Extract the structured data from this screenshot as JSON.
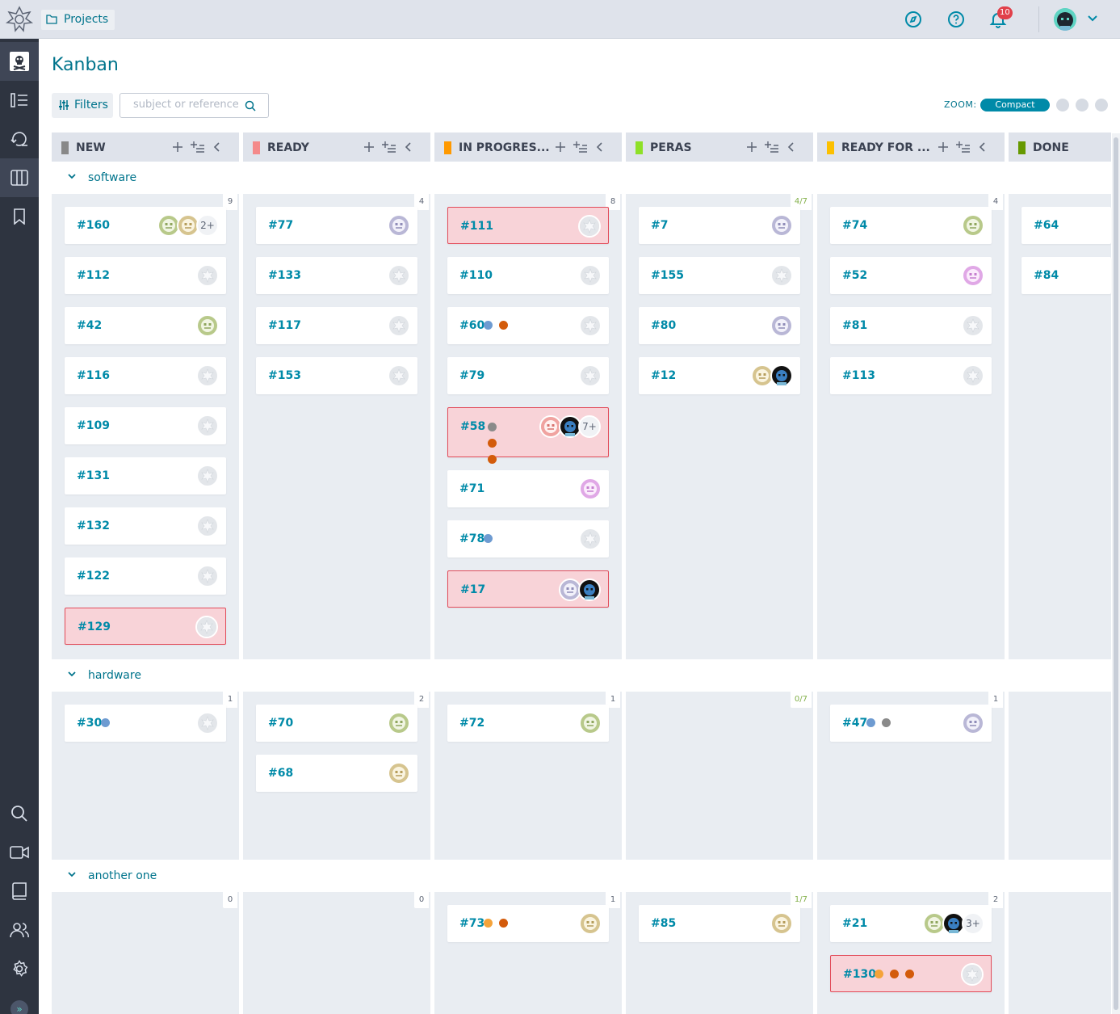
{
  "topbar": {
    "projects_label": "Projects",
    "notifications_count": "10",
    "icons": [
      "logo-icon",
      "folder-icon",
      "compass-icon",
      "help-icon",
      "bell-icon",
      "user-avatar",
      "chevron-down-icon"
    ]
  },
  "sidebar": {
    "items": [
      "project-logo-icon",
      "backlog-icon",
      "epics-icon",
      "kanban-icon",
      "bookmark-icon",
      "search-icon",
      "video-icon",
      "wiki-icon",
      "team-icon",
      "settings-icon"
    ],
    "expand_label": "»"
  },
  "page": {
    "title": "Kanban",
    "filters_label": "Filters",
    "search_placeholder": "subject or reference",
    "zoom_label": "ZOOM:",
    "zoom_active": "Compact"
  },
  "colors": {
    "accent": "#008aa8",
    "blocked_bg": "#f8d3d8",
    "blocked_border": "#e24c5a",
    "tag_blue": "#6e9bd1",
    "tag_orange": "#d35b0b",
    "tag_grey": "#8a8a8a",
    "tag_yellow": "#f5a33a",
    "tag_light": "#c7d3d8"
  },
  "columns": [
    {
      "name": "NEW",
      "color": "#888888"
    },
    {
      "name": "READY",
      "color": "#f48a8a"
    },
    {
      "name": "IN PROGRES...",
      "color": "#ff9900"
    },
    {
      "name": "PERAS",
      "color": "#8ee027"
    },
    {
      "name": "READY FOR ...",
      "color": "#fcc000"
    },
    {
      "name": "DONE",
      "color": "#669900"
    }
  ],
  "swimlanes": [
    {
      "name": "software",
      "counts": [
        "9",
        "4",
        "8",
        "4/7",
        "4",
        ""
      ],
      "cards": [
        [
          {
            "ref": "#160",
            "avatars": [
              "green",
              "tan"
            ],
            "more": "2+"
          },
          {
            "ref": "#112",
            "avatars": [
              "empty"
            ]
          },
          {
            "ref": "#42",
            "avatars": [
              "green"
            ]
          },
          {
            "ref": "#116",
            "avatars": [
              "empty"
            ]
          },
          {
            "ref": "#109",
            "avatars": [
              "empty"
            ]
          },
          {
            "ref": "#131",
            "avatars": [
              "empty"
            ]
          },
          {
            "ref": "#132",
            "avatars": [
              "empty"
            ]
          },
          {
            "ref": "#122",
            "avatars": [
              "empty"
            ]
          },
          {
            "ref": "#129",
            "avatars": [
              "empty"
            ],
            "blocked": true
          }
        ],
        [
          {
            "ref": "#77",
            "avatars": [
              "lavender"
            ]
          },
          {
            "ref": "#133",
            "avatars": [
              "empty"
            ]
          },
          {
            "ref": "#117",
            "avatars": [
              "empty"
            ]
          },
          {
            "ref": "#153",
            "avatars": [
              "empty"
            ]
          }
        ],
        [
          {
            "ref": "#111",
            "avatars": [
              "empty"
            ],
            "blocked": true
          },
          {
            "ref": "#110",
            "avatars": [
              "empty"
            ]
          },
          {
            "ref": "#60",
            "tags": [
              "blue",
              "orange"
            ],
            "avatars": [
              "empty"
            ]
          },
          {
            "ref": "#79",
            "avatars": [
              "empty"
            ]
          },
          {
            "ref": "#58",
            "tags": [
              "grey",
              "orange",
              "orange",
              "light"
            ],
            "avatars": [
              "pink",
              "dark"
            ],
            "more": "7+",
            "blocked": true
          },
          {
            "ref": "#71",
            "avatars": [
              "purple"
            ]
          },
          {
            "ref": "#78",
            "tags": [
              "blue"
            ],
            "avatars": [
              "empty"
            ]
          },
          {
            "ref": "#17",
            "avatars": [
              "lavender",
              "dark"
            ],
            "blocked": true
          }
        ],
        [
          {
            "ref": "#7",
            "avatars": [
              "lavender"
            ]
          },
          {
            "ref": "#155",
            "avatars": [
              "empty"
            ]
          },
          {
            "ref": "#80",
            "avatars": [
              "lavender"
            ]
          },
          {
            "ref": "#12",
            "avatars": [
              "tan",
              "dark"
            ]
          }
        ],
        [
          {
            "ref": "#74",
            "avatars": [
              "green"
            ]
          },
          {
            "ref": "#52",
            "avatars": [
              "purple"
            ]
          },
          {
            "ref": "#81",
            "avatars": [
              "empty"
            ]
          },
          {
            "ref": "#113",
            "avatars": [
              "empty"
            ]
          }
        ],
        [
          {
            "ref": "#64",
            "avatars": []
          },
          {
            "ref": "#84",
            "avatars": []
          }
        ]
      ]
    },
    {
      "name": "hardware",
      "counts": [
        "1",
        "2",
        "1",
        "0/7",
        "1",
        ""
      ],
      "cards": [
        [
          {
            "ref": "#30",
            "tags": [
              "blue"
            ],
            "avatars": [
              "empty"
            ]
          }
        ],
        [
          {
            "ref": "#70",
            "avatars": [
              "green"
            ]
          },
          {
            "ref": "#68",
            "avatars": [
              "tan"
            ]
          }
        ],
        [
          {
            "ref": "#72",
            "avatars": [
              "green"
            ]
          }
        ],
        [],
        [
          {
            "ref": "#47",
            "tags": [
              "blue",
              "grey"
            ],
            "avatars": [
              "lavender"
            ]
          }
        ],
        []
      ]
    },
    {
      "name": "another one",
      "counts": [
        "0",
        "0",
        "1",
        "1/7",
        "2",
        ""
      ],
      "cards": [
        [],
        [],
        [
          {
            "ref": "#73",
            "tags": [
              "yellow",
              "orange"
            ],
            "avatars": [
              "tan"
            ]
          }
        ],
        [
          {
            "ref": "#85",
            "avatars": [
              "tan"
            ]
          }
        ],
        [
          {
            "ref": "#21",
            "avatars": [
              "green",
              "dark"
            ],
            "more": "3+"
          },
          {
            "ref": "#130",
            "tags": [
              "yellow",
              "orange",
              "orange"
            ],
            "avatars": [
              "empty"
            ],
            "blocked": true
          }
        ],
        []
      ]
    }
  ]
}
